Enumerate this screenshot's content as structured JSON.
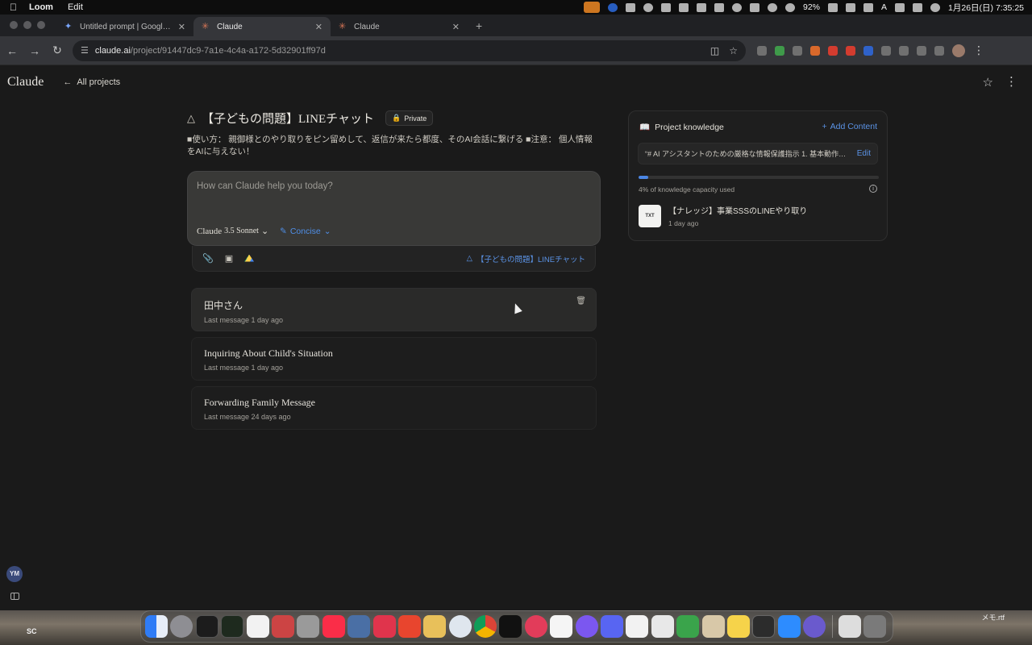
{
  "menubar": {
    "app_name": "Loom",
    "menu_edit": "Edit",
    "battery": "92%",
    "datetime": "1月26日(日) 7:35:25",
    "input_indicator": "A"
  },
  "tabs": [
    {
      "title": "Untitled prompt | Google AI S",
      "icon": "google-ai-studio-icon"
    },
    {
      "title": "Claude",
      "icon": "claude-icon",
      "active": true
    },
    {
      "title": "Claude",
      "icon": "claude-icon"
    }
  ],
  "address": {
    "host": "claude.ai",
    "path": "/project/91447dc9-7a1e-4c4a-a172-5d32901ff97d"
  },
  "header": {
    "logo": "Claude",
    "back_label": "All projects"
  },
  "project": {
    "title": "【子どもの問題】LINEチャット",
    "visibility": "Private",
    "description": "■使い方： 親御様とのやり取りをピン留めして、返信が来たら都度、そのAI会話に繋げる ■注意： 個人情報をAIに与えない！"
  },
  "composer": {
    "placeholder": "How can Claude help you today?",
    "model_name": "Claude",
    "model_version": "3.5 Sonnet",
    "style": "Concise",
    "project_chip": "【子どもの問題】LINEチャット"
  },
  "chats": [
    {
      "title": "田中さん",
      "meta": "Last message 1 day ago"
    },
    {
      "title": "Inquiring About Child's Situation",
      "meta": "Last message 1 day ago"
    },
    {
      "title": "Forwarding Family Message",
      "meta": "Last message 24 days ago"
    }
  ],
  "knowledge": {
    "heading": "Project knowledge",
    "add_label": "Add Content",
    "instructions_preview": "“# AI アシスタントのための厳格な情報保護指示 1. 基本動作原則: -...",
    "edit_label": "Edit",
    "capacity_percent": 4,
    "capacity_text": "4% of knowledge capacity used",
    "files": [
      {
        "type": "TXT",
        "name": "【ナレッジ】事業SSSのLINEやり取り",
        "meta": "1 day ago"
      }
    ]
  },
  "user": {
    "initials": "YM"
  },
  "desktop": {
    "left_label": "SC",
    "right_label": "メモ.rtf"
  },
  "colors": {
    "accent_blue": "#5b93e6",
    "background": "#1a1a1a",
    "composer": "#393937"
  }
}
